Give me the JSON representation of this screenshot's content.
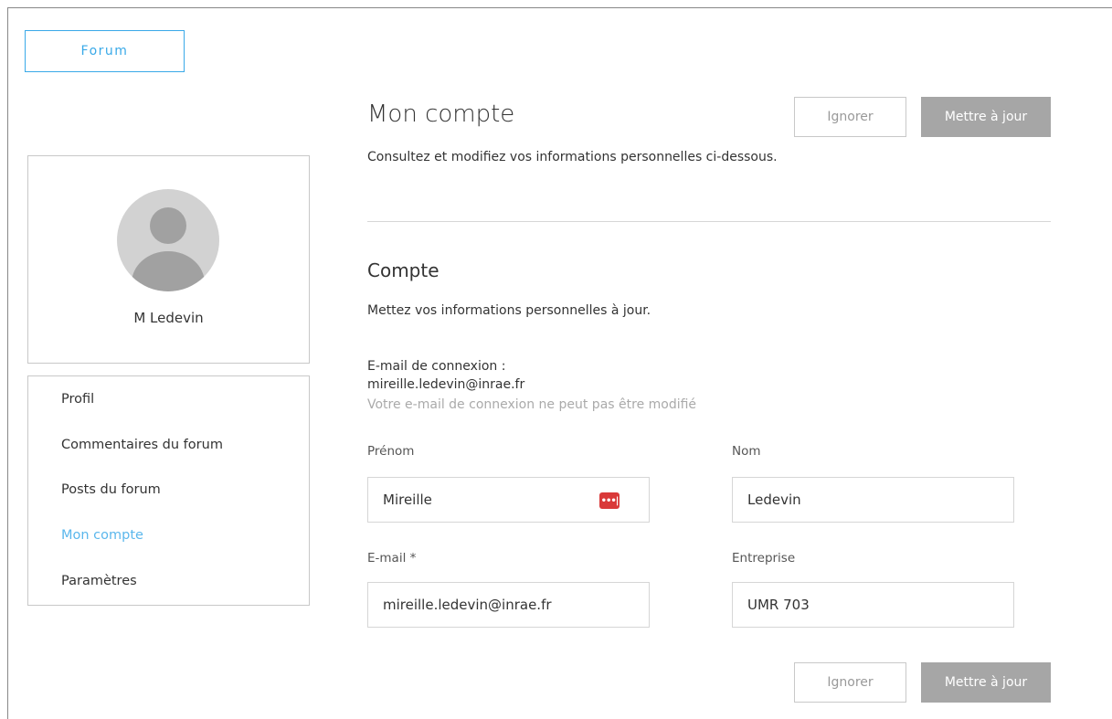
{
  "header": {
    "forum_label": "Forum"
  },
  "profile": {
    "name": "M Ledevin"
  },
  "nav": {
    "items": [
      {
        "label": "Profil"
      },
      {
        "label": "Commentaires du forum"
      },
      {
        "label": "Posts du forum"
      },
      {
        "label": "Mon compte"
      },
      {
        "label": "Paramètres"
      }
    ],
    "active": "Mon compte"
  },
  "main": {
    "title": "Mon compte",
    "description": "Consultez et modifiez vos informations personnelles ci-dessous.",
    "ignore_label": "Ignorer",
    "update_label": "Mettre à jour"
  },
  "account": {
    "title": "Compte",
    "description": "Mettez vos informations personnelles à jour.",
    "login_label": "E-mail de connexion :",
    "login_email": "mireille.ledevin@inrae.fr",
    "login_note": "Votre e-mail de connexion ne peut pas être modifié"
  },
  "form": {
    "first_name": {
      "label": "Prénom",
      "value": "Mireille"
    },
    "last_name": {
      "label": "Nom",
      "value": "Ledevin"
    },
    "email": {
      "label": "E-mail *",
      "value": "mireille.ledevin@inrae.fr"
    },
    "company": {
      "label": "Entreprise",
      "value": "UMR 703"
    }
  },
  "icons": {
    "password_manager": "password-manager-icon",
    "avatar": "default-user-avatar-icon"
  },
  "colors": {
    "accent": "#39a9e8",
    "active_nav": "#5bb7ec",
    "update_button": "#a6a6a6",
    "password_icon": "#d93939"
  }
}
